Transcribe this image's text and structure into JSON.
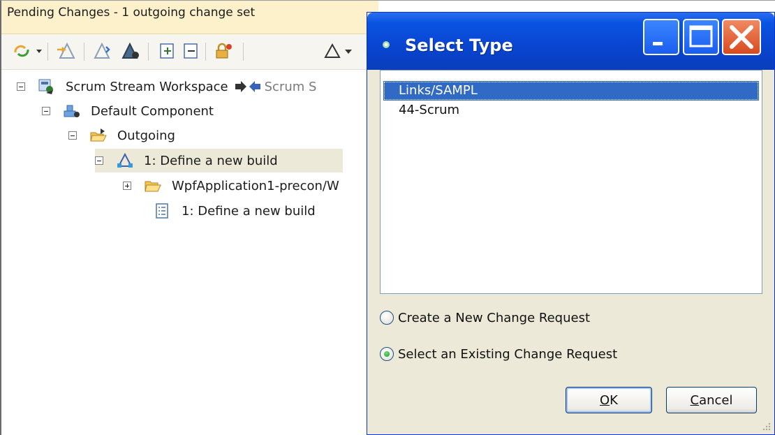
{
  "view": {
    "title": "Pending Changes - 1 outgoing change set"
  },
  "tree": {
    "workspace": "Scrum Stream Workspace",
    "workspace_target": "Scrum S",
    "component": "Default Component",
    "outgoing": "Outgoing",
    "change_set": "1: Define a new build",
    "folder": "WpfApplication1-precon/W",
    "work_item": "1: Define a new build"
  },
  "dialog": {
    "title": "Select Type",
    "list": [
      "Links/SAMPL",
      "44-Scrum"
    ],
    "selected_index": 0,
    "radio_new": "Create a New Change Request",
    "radio_existing": "Select an Existing Change Request",
    "radio_selected": "existing",
    "ok_label": "OK",
    "cancel_label": "Cancel"
  },
  "colors": {
    "titlebar_blue": "#0a46d2",
    "selection_blue": "#316ac5",
    "view_title_bg": "#fdf1cb",
    "close_red": "#d84a1f"
  }
}
